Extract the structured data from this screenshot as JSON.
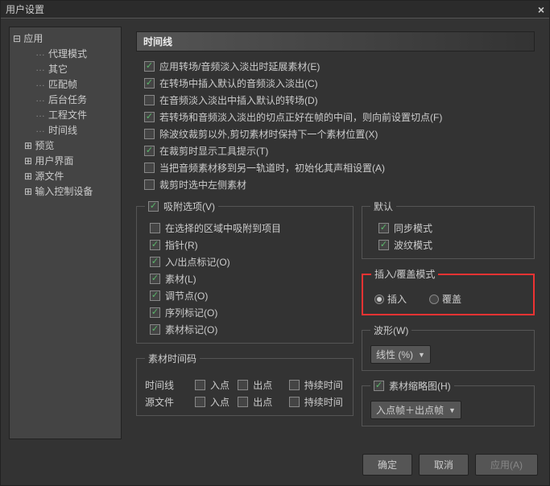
{
  "title": "用户设置",
  "sidebar": {
    "root": "应用",
    "children": [
      "代理模式",
      "其它",
      "匹配帧",
      "后台任务",
      "工程文件",
      "时间线"
    ],
    "subs": [
      "预览",
      "用户界面",
      "源文件",
      "输入控制设备"
    ]
  },
  "section_header": "时间线",
  "checks": [
    {
      "label": "应用转场/音频淡入淡出时延展素材(E)",
      "checked": true
    },
    {
      "label": "在转场中插入默认的音频淡入淡出(C)",
      "checked": true
    },
    {
      "label": "在音频淡入淡出中插入默认的转场(D)",
      "checked": false
    },
    {
      "label": "若转场和音频淡入淡出的切点正好在帧的中间，则向前设置切点(F)",
      "checked": true
    },
    {
      "label": "除波纹裁剪以外,剪切素材时保持下一个素材位置(X)",
      "checked": false
    },
    {
      "label": "在裁剪时显示工具提示(T)",
      "checked": true
    },
    {
      "label": "当把音频素材移到另一轨道时，初始化其声相设置(A)",
      "checked": false
    },
    {
      "label": "裁剪时选中左侧素材",
      "checked": false
    }
  ],
  "snap": {
    "title": "吸附选项(V)",
    "checked": true,
    "items": [
      {
        "label": "在选择的区域中吸附到项目",
        "checked": false
      },
      {
        "label": "指针(R)",
        "checked": true
      },
      {
        "label": "入/出点标记(O)",
        "checked": true
      },
      {
        "label": "素材(L)",
        "checked": true
      },
      {
        "label": "调节点(O)",
        "checked": true
      },
      {
        "label": "序列标记(O)",
        "checked": true
      },
      {
        "label": "素材标记(O)",
        "checked": true
      }
    ]
  },
  "defaults": {
    "title": "默认",
    "sync": {
      "label": "同步模式",
      "checked": true
    },
    "ripple": {
      "label": "波纹模式",
      "checked": true
    }
  },
  "insert_mode": {
    "title": "插入/覆盖模式",
    "insert": "插入",
    "overwrite": "覆盖"
  },
  "waveform": {
    "title": "波形(W)",
    "value": "线性 (%)"
  },
  "thumbnail": {
    "title": "素材缩略图(H)",
    "checked": true,
    "value": "入点帧＋出点帧"
  },
  "timecode": {
    "title": "素材时间码",
    "row1": "时间线",
    "row2": "源文件",
    "cols": [
      "入点",
      "出点",
      "持续时间"
    ]
  },
  "buttons": {
    "ok": "确定",
    "cancel": "取消",
    "apply": "应用(A)"
  }
}
